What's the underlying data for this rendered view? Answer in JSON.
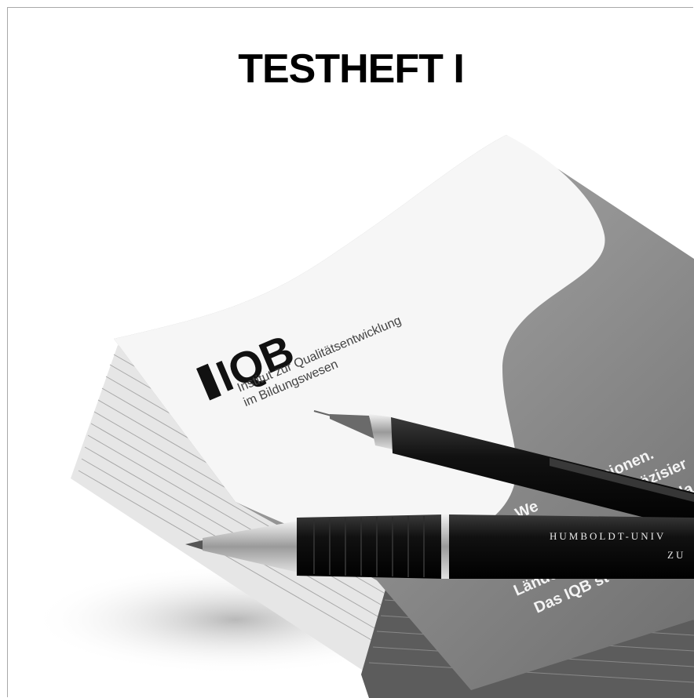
{
  "title": "TESTHEFT I",
  "photo": {
    "logo_text": "IQB",
    "institute_line1": "Institut zur Qualitätsentwicklung",
    "institute_line2": "im Bildungswesen",
    "pen_engraving_line1": "HUMBOLDT-UNIV",
    "pen_engraving_line2": "ZU",
    "cover_fragments": [
      "sionen.",
      "Präzisier",
      "nda",
      "Lände",
      "Das IQB st",
      "We"
    ]
  }
}
